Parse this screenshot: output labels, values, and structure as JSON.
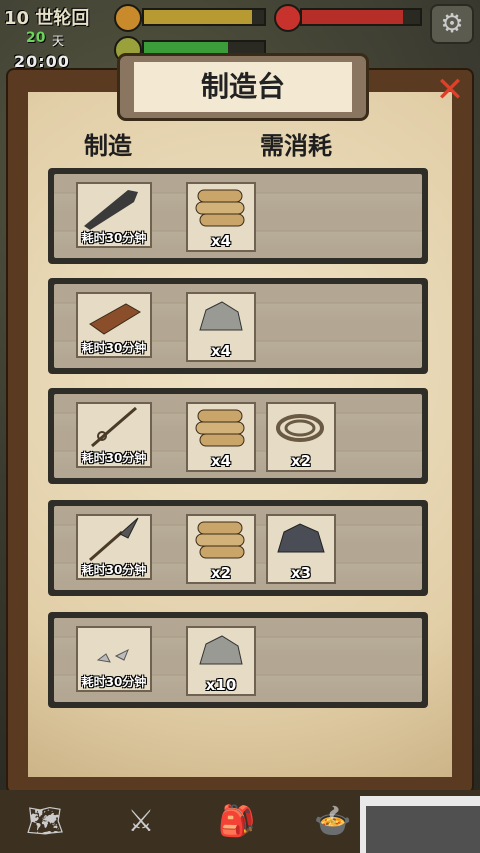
{
  "hud": {
    "round_label": "10 世轮回",
    "days": "20",
    "days_unit": "天",
    "clock": "20:00",
    "hunger_level": 0.9,
    "health_level": 0.86,
    "thirst_level": 0.7,
    "colors": {
      "hunger": "#b79a32",
      "health": "#b52f28",
      "thirst": "#3b9d3a"
    }
  },
  "panel": {
    "title": "制造台",
    "col_craft": "制造",
    "col_cost": "需消耗",
    "close_icon": "close-x-icon"
  },
  "recipes": [
    {
      "product_icon": "club-icon",
      "time": "耗时30分钟",
      "materials": [
        {
          "icon": "wood-logs-icon",
          "qty": "x4"
        }
      ]
    },
    {
      "product_icon": "brick-icon",
      "time": "耗时30分钟",
      "materials": [
        {
          "icon": "stone-icon",
          "qty": "x4"
        }
      ]
    },
    {
      "product_icon": "fishing-rod-icon",
      "time": "耗时30分钟",
      "materials": [
        {
          "icon": "wood-logs-icon",
          "qty": "x4"
        },
        {
          "icon": "rope-icon",
          "qty": "x2"
        }
      ]
    },
    {
      "product_icon": "spear-icon",
      "time": "耗时30分钟",
      "materials": [
        {
          "icon": "wood-logs-icon",
          "qty": "x2"
        },
        {
          "icon": "iron-ore-icon",
          "qty": "x3"
        }
      ]
    },
    {
      "product_icon": "stone-shards-icon",
      "time": "耗时30分钟",
      "materials": [
        {
          "icon": "stone-icon",
          "qty": "x10"
        }
      ]
    }
  ],
  "bottom_nav": [
    "map-icon",
    "crossed-swords-icon",
    "backpack-icon",
    "cooking-pot-icon"
  ]
}
